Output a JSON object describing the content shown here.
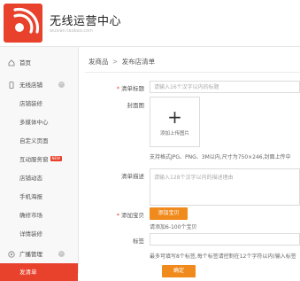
{
  "header": {
    "title": "无线运营中心",
    "subtitle": "wuxian.taobao.com"
  },
  "sidebar": {
    "items": [
      {
        "label": "首页",
        "icon": "home-icon"
      },
      {
        "label": "无线店铺",
        "icon": "phone-icon",
        "toggle": "−"
      },
      {
        "label": "店铺装修"
      },
      {
        "label": "多媒体中心"
      },
      {
        "label": "自定义页面"
      },
      {
        "label": "互动服务窗",
        "badge": "NEW"
      },
      {
        "label": "店铺动态"
      },
      {
        "label": "手机海报"
      },
      {
        "label": "确修市场"
      },
      {
        "label": "详情装修"
      },
      {
        "label": "广播管理",
        "icon": "broadcast-icon",
        "toggle": "−"
      },
      {
        "label": "发清单"
      }
    ]
  },
  "breadcrumb": {
    "parent": "发商品",
    "separator": ">",
    "current": "发布店清单"
  },
  "form": {
    "title_label": "清单标题",
    "title_required": "*",
    "title_placeholder": "请输入16个汉字以内的标题",
    "cover_label": "封面图",
    "upload_plus": "+",
    "upload_label": "添加上传图片",
    "cover_hint": "支持格式JPG、PNG、3M以内,尺寸为750×246,封面上传中",
    "desc_label": "清单描述",
    "desc_placeholder": "请输入128个汉字以内的描述理由",
    "items_label": "添加宝贝",
    "items_required": "*",
    "add_items_button": "添加宝贝",
    "items_hint": "请添加6-100个宝贝",
    "tags_label": "标签",
    "tags_hint": "最多可填写8个标签,每个标签请控制在12个字符以内(输入标签",
    "confirm_button": "确定"
  },
  "colors": {
    "brand_red": "#e8412c",
    "accent_orange": "#f08a1c"
  }
}
